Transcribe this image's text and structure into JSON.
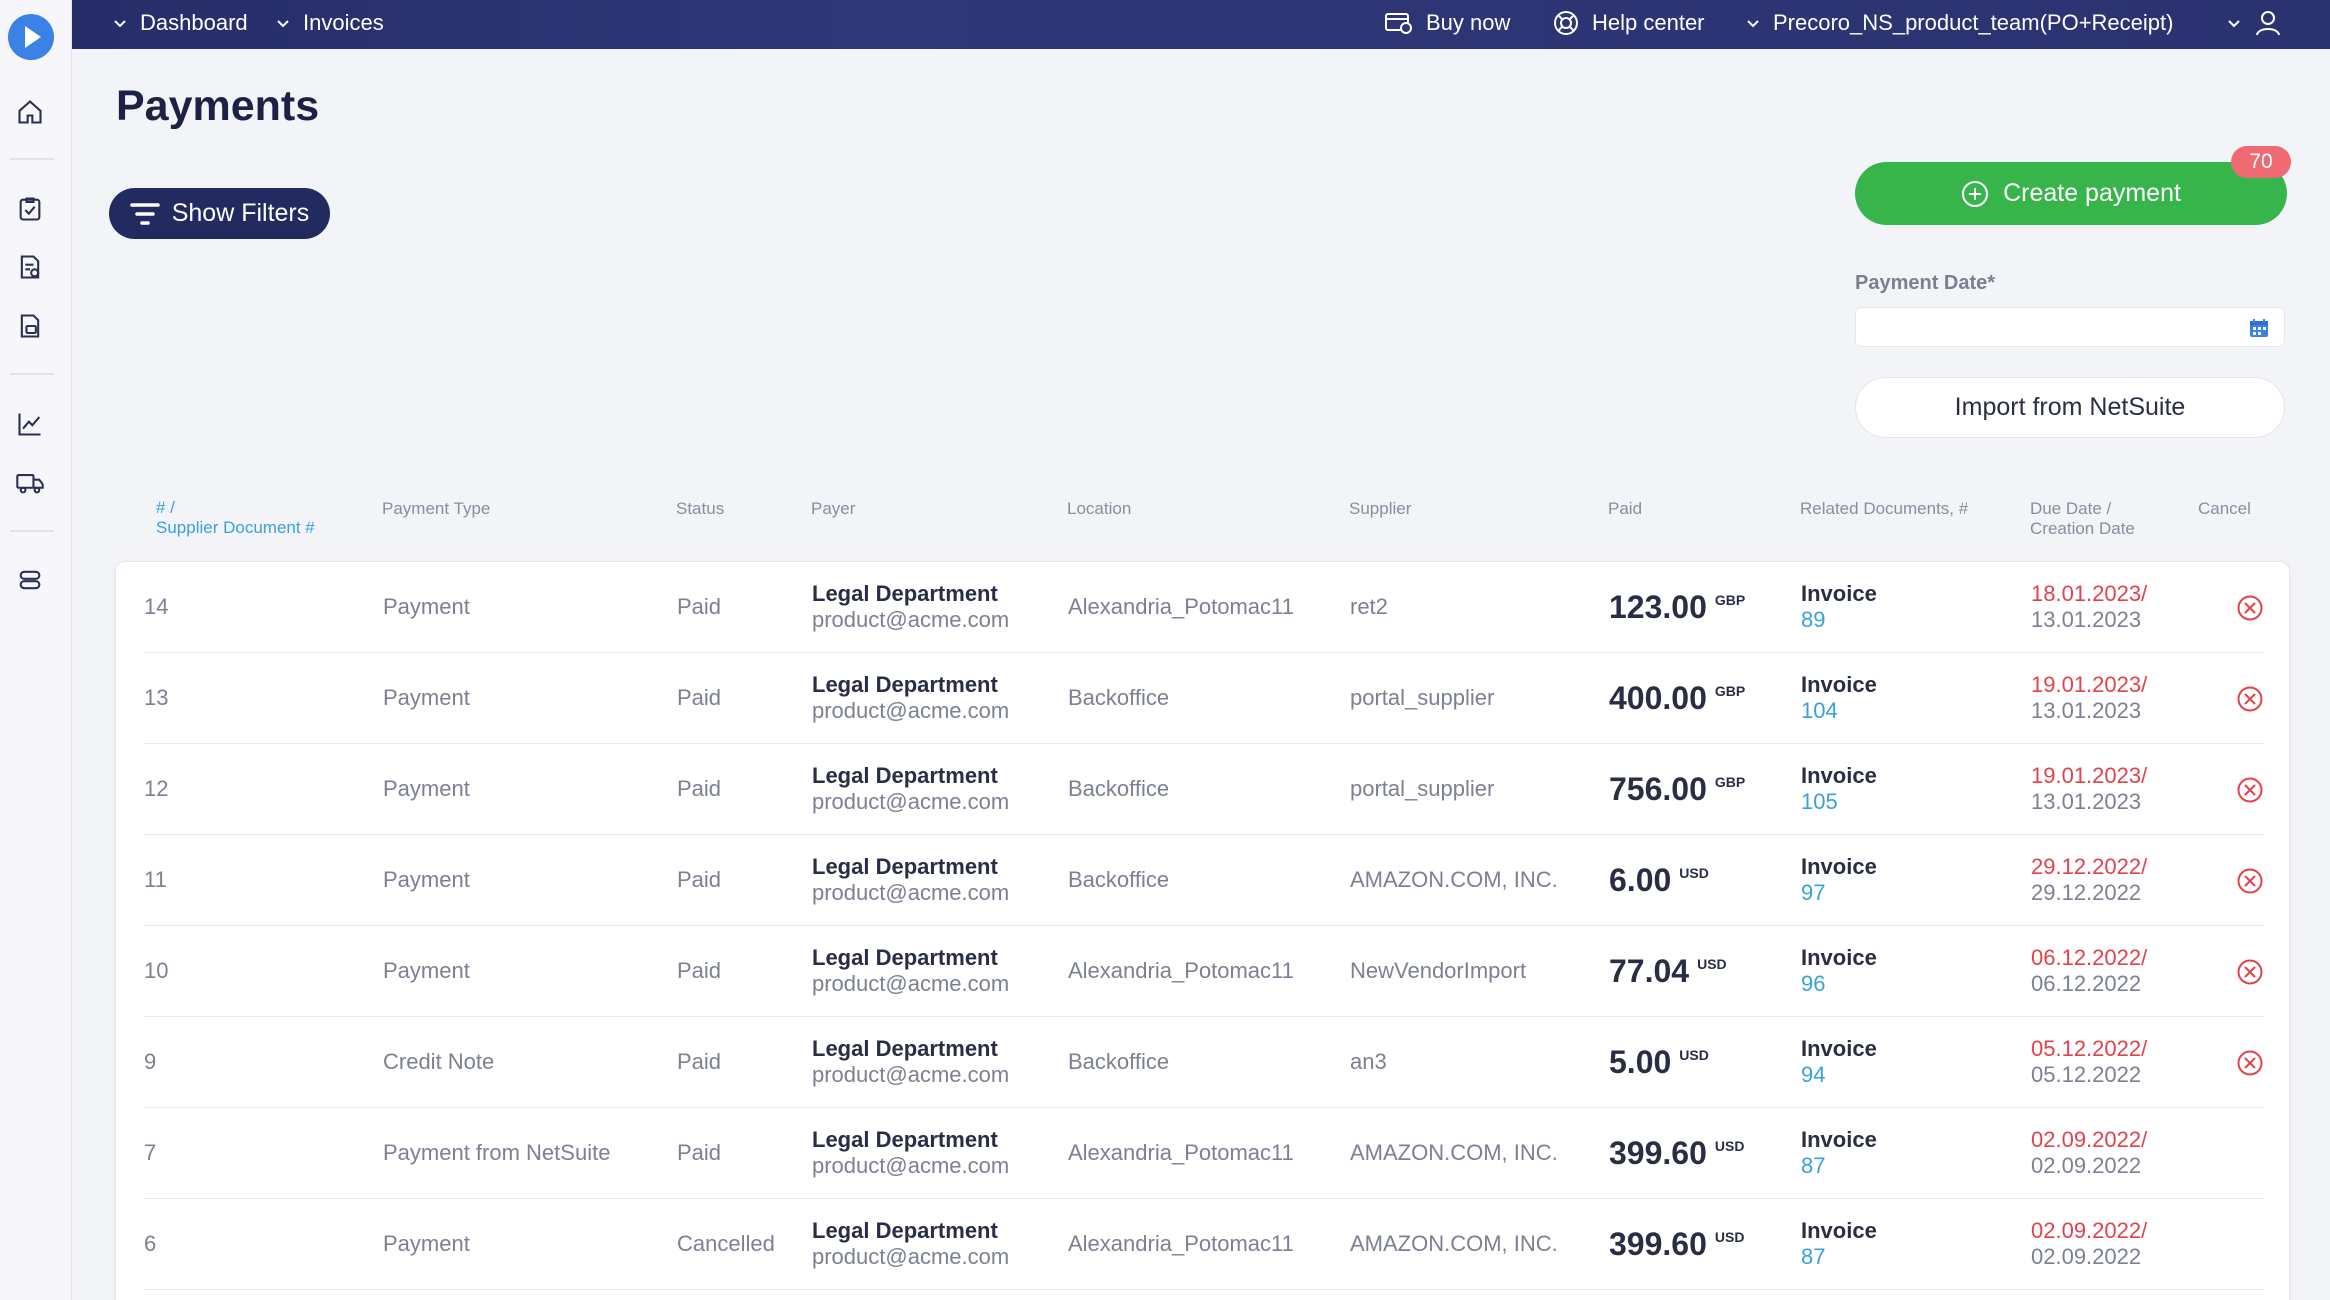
{
  "topbar": {
    "breadcrumbs": [
      {
        "label": "Dashboard"
      },
      {
        "label": "Invoices"
      }
    ],
    "buy_now": "Buy now",
    "help_center": "Help center",
    "company": "Precoro_NS_product_team(PO+Receipt)"
  },
  "sidebar": {
    "items": [
      {
        "icon": "home-icon"
      },
      {
        "icon": "clipboard-check-icon"
      },
      {
        "icon": "document-check-icon"
      },
      {
        "icon": "invoice-icon"
      },
      {
        "icon": "analytics-chart-icon"
      },
      {
        "icon": "truck-icon"
      },
      {
        "icon": "settings-stack-icon"
      }
    ]
  },
  "page": {
    "title": "Payments",
    "show_filters": "Show Filters",
    "create_payment": "Create payment",
    "create_badge": "70",
    "payment_date_label": "Payment Date*",
    "payment_date_value": "",
    "import_netsuite": "Import from NetSuite"
  },
  "table": {
    "headers": {
      "id_line1": "# /",
      "id_line2": "Supplier Document #",
      "payment_type": "Payment Type",
      "status": "Status",
      "payer": "Payer",
      "location": "Location",
      "supplier": "Supplier",
      "paid": "Paid",
      "related_docs": "Related Documents, #",
      "due_line1": "Due Date /",
      "due_line2": "Creation Date",
      "cancel": "Cancel"
    },
    "rows": [
      {
        "id": "14",
        "type": "Payment",
        "status": "Paid",
        "payer_name": "Legal Department",
        "payer_email": "product@acme.com",
        "location": "Alexandria_Potomac11",
        "supplier": "ret2",
        "amount": "123.00",
        "currency": "GBP",
        "doc_type": "Invoice",
        "doc_num": "89",
        "due": "18.01.2023/",
        "created": "13.01.2023",
        "cancellable": true
      },
      {
        "id": "13",
        "type": "Payment",
        "status": "Paid",
        "payer_name": "Legal Department",
        "payer_email": "product@acme.com",
        "location": "Backoffice",
        "supplier": "portal_supplier",
        "amount": "400.00",
        "currency": "GBP",
        "doc_type": "Invoice",
        "doc_num": "104",
        "due": "19.01.2023/",
        "created": "13.01.2023",
        "cancellable": true
      },
      {
        "id": "12",
        "type": "Payment",
        "status": "Paid",
        "payer_name": "Legal Department",
        "payer_email": "product@acme.com",
        "location": "Backoffice",
        "supplier": "portal_supplier",
        "amount": "756.00",
        "currency": "GBP",
        "doc_type": "Invoice",
        "doc_num": "105",
        "due": "19.01.2023/",
        "created": "13.01.2023",
        "cancellable": true
      },
      {
        "id": "11",
        "type": "Payment",
        "status": "Paid",
        "payer_name": "Legal Department",
        "payer_email": "product@acme.com",
        "location": "Backoffice",
        "supplier": "AMAZON.COM, INC.",
        "amount": "6.00",
        "currency": "USD",
        "doc_type": "Invoice",
        "doc_num": "97",
        "due": "29.12.2022/",
        "created": "29.12.2022",
        "cancellable": true
      },
      {
        "id": "10",
        "type": "Payment",
        "status": "Paid",
        "payer_name": "Legal Department",
        "payer_email": "product@acme.com",
        "location": "Alexandria_Potomac11",
        "supplier": "NewVendorImport",
        "amount": "77.04",
        "currency": "USD",
        "doc_type": "Invoice",
        "doc_num": "96",
        "due": "06.12.2022/",
        "created": "06.12.2022",
        "cancellable": true
      },
      {
        "id": "9",
        "type": "Credit Note",
        "status": "Paid",
        "payer_name": "Legal Department",
        "payer_email": "product@acme.com",
        "location": "Backoffice",
        "supplier": "an3",
        "amount": "5.00",
        "currency": "USD",
        "doc_type": "Invoice",
        "doc_num": "94",
        "due": "05.12.2022/",
        "created": "05.12.2022",
        "cancellable": true
      },
      {
        "id": "7",
        "type": "Payment from NetSuite",
        "status": "Paid",
        "payer_name": "Legal Department",
        "payer_email": "product@acme.com",
        "location": "Alexandria_Potomac11",
        "supplier": "AMAZON.COM, INC.",
        "amount": "399.60",
        "currency": "USD",
        "doc_type": "Invoice",
        "doc_num": "87",
        "due": "02.09.2022/",
        "created": "02.09.2022",
        "cancellable": false
      },
      {
        "id": "6",
        "type": "Payment",
        "status": "Cancelled",
        "payer_name": "Legal Department",
        "payer_email": "product@acme.com",
        "location": "Alexandria_Potomac11",
        "supplier": "AMAZON.COM, INC.",
        "amount": "399.60",
        "currency": "USD",
        "doc_type": "Invoice",
        "doc_num": "87",
        "due": "02.09.2022/",
        "created": "02.09.2022",
        "cancellable": false
      }
    ]
  },
  "colors": {
    "topbar": "#2b3270",
    "accent_green": "#37b54a",
    "badge_red": "#ef6a73",
    "link_blue": "#3aa0dc",
    "due_red": "#e2424b",
    "filter_navy": "#232a5f"
  }
}
